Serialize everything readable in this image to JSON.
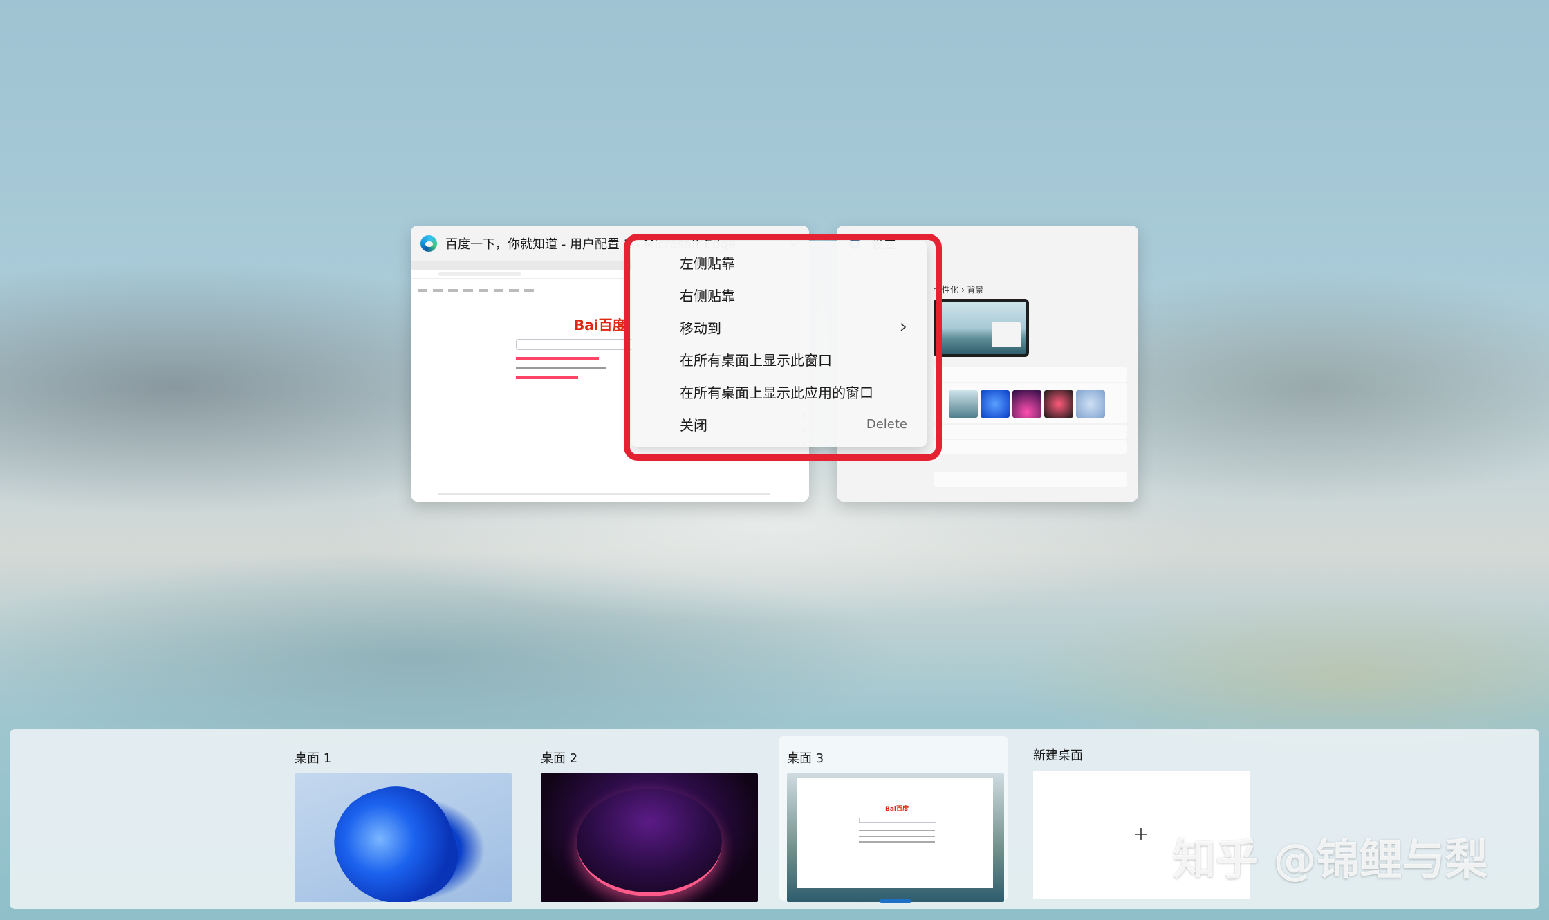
{
  "windows": {
    "edge": {
      "title": "百度一下，你就知道 - 用户配置 1 - Microsoft Edge",
      "page_logo": "Bai百度"
    },
    "settings": {
      "title": "设置",
      "breadcrumb": "个性化 › 背景"
    }
  },
  "context_menu": {
    "items": [
      {
        "label": "左侧贴靠"
      },
      {
        "label": "右侧贴靠"
      },
      {
        "label": "移动到",
        "has_submenu": true
      },
      {
        "label": "在所有桌面上显示此窗口"
      },
      {
        "label": "在所有桌面上显示此应用的窗口"
      },
      {
        "label": "关闭",
        "shortcut": "Delete"
      }
    ],
    "highlight_color": "#e52231"
  },
  "desktops": [
    {
      "label": "桌面 1"
    },
    {
      "label": "桌面 2"
    },
    {
      "label": "桌面 3",
      "active": true
    },
    {
      "label": "新建桌面"
    }
  ],
  "accent_color": "#1f6fc7",
  "watermark": "知乎 @锦鲤与梨"
}
